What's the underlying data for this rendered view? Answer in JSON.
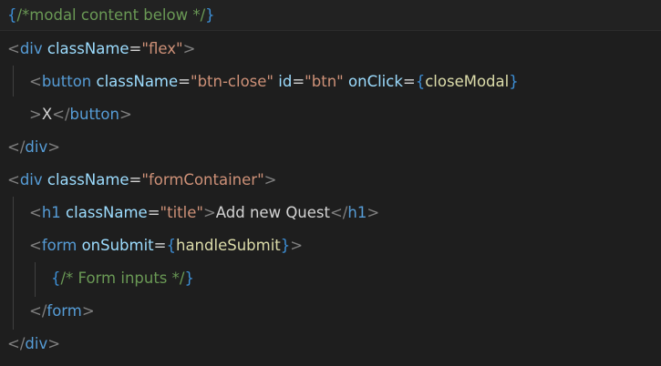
{
  "editor": {
    "lines": [
      {
        "tokens": [
          {
            "text": "{",
            "cls": "c-brace"
          },
          {
            "text": "/*modal content below */",
            "cls": "c-comment"
          },
          {
            "text": "}",
            "cls": "c-brace"
          }
        ]
      },
      {
        "tokens": [
          {
            "text": "<",
            "cls": "c-punct"
          },
          {
            "text": "div",
            "cls": "c-tag"
          },
          {
            "text": " ",
            "cls": "c-text"
          },
          {
            "text": "className",
            "cls": "c-attr"
          },
          {
            "text": "=",
            "cls": "c-eq"
          },
          {
            "text": "\"flex\"",
            "cls": "c-str"
          },
          {
            "text": ">",
            "cls": "c-punct"
          }
        ]
      },
      {
        "tokens": [
          {
            "text": "<",
            "cls": "c-punct"
          },
          {
            "text": "button",
            "cls": "c-tag"
          },
          {
            "text": " ",
            "cls": "c-text"
          },
          {
            "text": "className",
            "cls": "c-attr"
          },
          {
            "text": "=",
            "cls": "c-eq"
          },
          {
            "text": "\"btn-close\"",
            "cls": "c-str"
          },
          {
            "text": " ",
            "cls": "c-text"
          },
          {
            "text": "id",
            "cls": "c-attr"
          },
          {
            "text": "=",
            "cls": "c-eq"
          },
          {
            "text": "\"btn\"",
            "cls": "c-str"
          },
          {
            "text": " ",
            "cls": "c-text"
          },
          {
            "text": "onClick",
            "cls": "c-attr"
          },
          {
            "text": "=",
            "cls": "c-eq"
          },
          {
            "text": "{",
            "cls": "c-brace"
          },
          {
            "text": "closeModal",
            "cls": "c-func"
          },
          {
            "text": "}",
            "cls": "c-brace"
          }
        ]
      },
      {
        "tokens": [
          {
            "text": ">",
            "cls": "c-punct"
          },
          {
            "text": "X",
            "cls": "c-text"
          },
          {
            "text": "</",
            "cls": "c-punct"
          },
          {
            "text": "button",
            "cls": "c-tag"
          },
          {
            "text": ">",
            "cls": "c-punct"
          }
        ]
      },
      {
        "tokens": [
          {
            "text": "</",
            "cls": "c-punct"
          },
          {
            "text": "div",
            "cls": "c-tag"
          },
          {
            "text": ">",
            "cls": "c-punct"
          }
        ]
      },
      {
        "tokens": [
          {
            "text": "<",
            "cls": "c-punct"
          },
          {
            "text": "div",
            "cls": "c-tag"
          },
          {
            "text": " ",
            "cls": "c-text"
          },
          {
            "text": "className",
            "cls": "c-attr"
          },
          {
            "text": "=",
            "cls": "c-eq"
          },
          {
            "text": "\"formContainer\"",
            "cls": "c-str"
          },
          {
            "text": ">",
            "cls": "c-punct"
          }
        ]
      },
      {
        "tokens": [
          {
            "text": "<",
            "cls": "c-punct"
          },
          {
            "text": "h1",
            "cls": "c-tag"
          },
          {
            "text": " ",
            "cls": "c-text"
          },
          {
            "text": "className",
            "cls": "c-attr"
          },
          {
            "text": "=",
            "cls": "c-eq"
          },
          {
            "text": "\"title\"",
            "cls": "c-str"
          },
          {
            "text": ">",
            "cls": "c-punct"
          },
          {
            "text": "Add new Quest",
            "cls": "c-text"
          },
          {
            "text": "</",
            "cls": "c-punct"
          },
          {
            "text": "h1",
            "cls": "c-tag"
          },
          {
            "text": ">",
            "cls": "c-punct"
          }
        ]
      },
      {
        "tokens": [
          {
            "text": "<",
            "cls": "c-punct"
          },
          {
            "text": "form",
            "cls": "c-tag"
          },
          {
            "text": " ",
            "cls": "c-text"
          },
          {
            "text": "onSubmit",
            "cls": "c-attr"
          },
          {
            "text": "=",
            "cls": "c-eq"
          },
          {
            "text": "{",
            "cls": "c-brace"
          },
          {
            "text": "handleSubmit",
            "cls": "c-func"
          },
          {
            "text": "}",
            "cls": "c-brace"
          },
          {
            "text": ">",
            "cls": "c-punct"
          }
        ]
      },
      {
        "tokens": [
          {
            "text": "{",
            "cls": "c-brace"
          },
          {
            "text": "/* Form inputs */",
            "cls": "c-comment"
          },
          {
            "text": "}",
            "cls": "c-brace"
          }
        ]
      },
      {
        "tokens": [
          {
            "text": "</",
            "cls": "c-punct"
          },
          {
            "text": "form",
            "cls": "c-tag"
          },
          {
            "text": ">",
            "cls": "c-punct"
          }
        ]
      },
      {
        "tokens": [
          {
            "text": "</",
            "cls": "c-punct"
          },
          {
            "text": "div",
            "cls": "c-tag"
          },
          {
            "text": ">",
            "cls": "c-punct"
          }
        ]
      }
    ]
  },
  "colors": {
    "background": "#1e1e1e",
    "tag": "#569cd6",
    "attribute": "#9cdcfe",
    "string": "#ce9178",
    "comment": "#6a9955",
    "function": "#dcdcaa",
    "brace": "#3d8fd6",
    "punctuation": "#808080",
    "text": "#d4d4d4"
  }
}
